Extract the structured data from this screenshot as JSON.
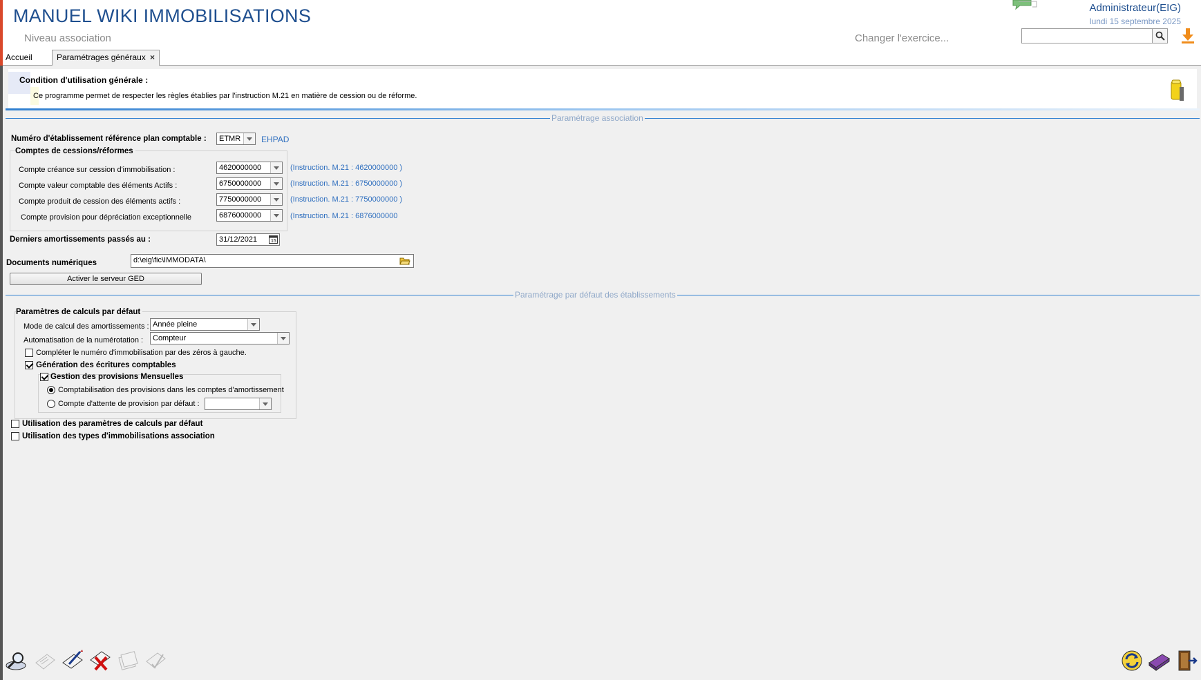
{
  "header": {
    "app_title": "MANUEL WIKI IMMOBILISATIONS",
    "subtitle": "Niveau association",
    "change_exercise": "Changer l'exercice...",
    "user": "Administrateur(EIG)",
    "date": "lundi 15 septembre 2025",
    "search_value": ""
  },
  "tabs": {
    "home": "Accueil",
    "active": "Paramétrages généraux",
    "close": "×"
  },
  "condition": {
    "title": "Condition d'utilisation générale :",
    "text": "Ce programme permet de respecter les règles établies par l'instruction M.21 en matière de cession ou de réforme."
  },
  "section1": {
    "label": "Paramétrage association",
    "etab_label": "Numéro d'établissement référence plan comptable :",
    "etab_value": "ETMR",
    "etab_name": "EHPAD",
    "group_title": "Comptes de cessions/réformes",
    "rows": [
      {
        "label": "Compte créance sur cession d'immobilisation :",
        "value": "4620000000",
        "hint": "(Instruction. M.21 : 4620000000 )"
      },
      {
        "label": "Compte valeur comptable des éléments Actifs :",
        "value": "6750000000",
        "hint": "(Instruction. M.21 : 6750000000 )"
      },
      {
        "label": "Compte produit de cession des éléments actifs :",
        "value": "7750000000",
        "hint": "(Instruction. M.21 : 7750000000 )"
      },
      {
        "label": "Compte provision pour dépréciation exceptionnelle",
        "value": "6876000000",
        "hint": "(Instruction. M.21 : 6876000000"
      }
    ],
    "amort_label": "Derniers amortissements passés au :",
    "amort_value": "31/12/2021",
    "docs_label": "Documents numériques",
    "docs_value": "d:\\eig\\fic\\IMMODATA\\",
    "ged_button": "Activer le serveur GED"
  },
  "section2": {
    "label": "Paramétrage par défaut des établissements",
    "group_title": "Paramètres de calculs par défaut",
    "mode_label": "Mode de calcul des amortissements :",
    "mode_value": "Année pleine",
    "auto_label": "Automatisation de la numérotation :",
    "auto_value": "Compteur",
    "complete_label": "Compléter le numéro d'immobilisation par des zéros à gauche.",
    "generation_label": "Génération des écritures comptables",
    "gestion_label": "Gestion des provisions Mensuelles",
    "radio1_label": "Comptabilisation des provisions dans les comptes d'amortissement",
    "radio2_label": "Compte d'attente de provision par défaut :",
    "radio2_value": "",
    "use_params_label": "Utilisation des paramètres de calculs par défaut",
    "use_types_label": "Utilisation des types d'immobilisations association"
  },
  "state": {
    "complete_checked": false,
    "generation_checked": true,
    "gestion_checked": true,
    "radio_selected": 1,
    "use_params_checked": false,
    "use_types_checked": false
  },
  "colors": {
    "title_blue": "#1f4f8f",
    "link_blue": "#2f6fbf",
    "section_line": "#2f7fd0",
    "background": "#f0f0f0"
  }
}
